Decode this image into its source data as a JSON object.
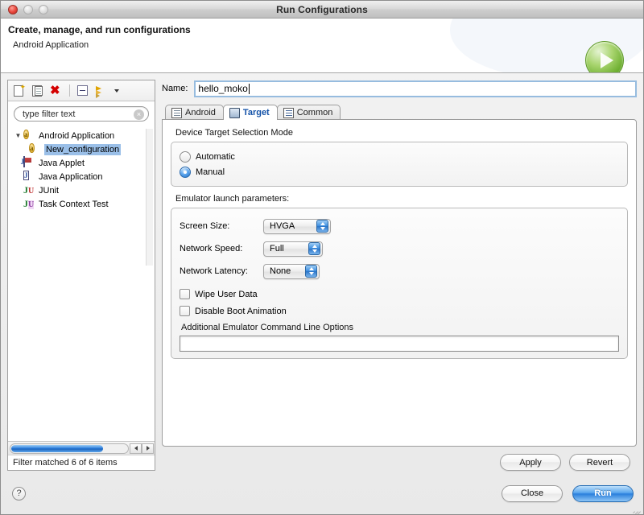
{
  "window": {
    "title": "Run Configurations",
    "traffic_lights": [
      "close",
      "minimize",
      "zoom"
    ]
  },
  "header": {
    "title": "Create, manage, and run configurations",
    "subtitle": "Android Application",
    "icon": "green-run-play-icon"
  },
  "sidebar": {
    "toolbar": [
      {
        "name": "new-configuration-icon",
        "label": "New launch configuration"
      },
      {
        "name": "duplicate-configuration-icon",
        "label": "Duplicate"
      },
      {
        "name": "delete-configuration-icon",
        "label": "Delete"
      },
      {
        "name": "collapse-all-icon",
        "label": "Collapse All"
      },
      {
        "name": "filter-configurations-icon",
        "label": "Filter"
      }
    ],
    "filter": {
      "placeholder": "type filter text",
      "value": "",
      "clear_glyph": "×"
    },
    "tree": [
      {
        "label": "Android Application",
        "icon": "android-config-icon",
        "expanded": true,
        "level": 0,
        "selected": false,
        "twisty": "▼"
      },
      {
        "label": "New_configuration",
        "icon": "android-config-icon",
        "level": 1,
        "selected": true,
        "twisty": ""
      },
      {
        "label": "Java Applet",
        "icon": "java-applet-icon",
        "level": 0,
        "selected": false,
        "twisty": ""
      },
      {
        "label": "Java Application",
        "icon": "java-application-icon",
        "level": 0,
        "selected": false,
        "twisty": ""
      },
      {
        "label": "JUnit",
        "icon": "junit-icon",
        "level": 0,
        "selected": false,
        "twisty": ""
      },
      {
        "label": "Task Context Test",
        "icon": "task-context-test-icon",
        "level": 0,
        "selected": false,
        "twisty": ""
      }
    ],
    "status": "Filter matched 6 of 6 items"
  },
  "main": {
    "name_field": {
      "label": "Name:",
      "value": "hello_moko"
    },
    "tabs": [
      {
        "label": "Android",
        "icon": "android-tab-icon",
        "active": false
      },
      {
        "label": "Target",
        "icon": "target-device-icon",
        "active": true
      },
      {
        "label": "Common",
        "icon": "common-tab-icon",
        "active": false
      }
    ],
    "target_tab": {
      "selection_mode_label": "Device Target Selection Mode",
      "radios": [
        {
          "label": "Automatic",
          "selected": false
        },
        {
          "label": "Manual",
          "selected": true
        }
      ],
      "emulator_label": "Emulator launch parameters:",
      "params": [
        {
          "label": "Screen Size:",
          "value": "HVGA"
        },
        {
          "label": "Network Speed:",
          "value": "Full"
        },
        {
          "label": "Network Latency:",
          "value": "None"
        }
      ],
      "checkboxes": [
        {
          "label": "Wipe User Data",
          "checked": false
        },
        {
          "label": "Disable Boot Animation",
          "checked": false
        }
      ],
      "additional_options_label": "Additional Emulator Command Line Options",
      "additional_options_value": ""
    },
    "apply_label": "Apply",
    "revert_label": "Revert"
  },
  "footer": {
    "help_glyph": "?",
    "close_label": "Close",
    "run_label": "Run"
  },
  "colors": {
    "accent_blue": "#2a7fdc",
    "selection_blue": "#9abfe8",
    "tab_active_text": "#1352a8",
    "window_bg": "#ededed",
    "panel_white": "#ffffff"
  }
}
